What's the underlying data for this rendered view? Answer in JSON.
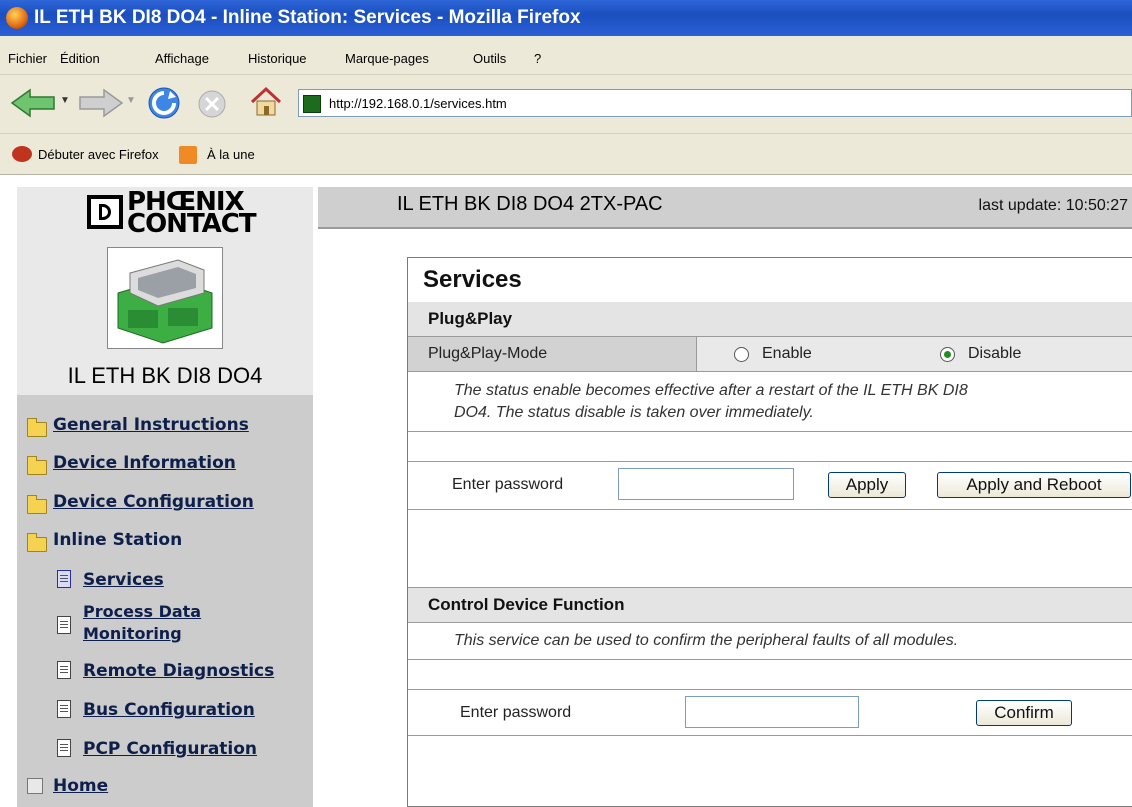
{
  "window": {
    "title": "IL ETH BK DI8 DO4 - Inline Station: Services - Mozilla Firefox"
  },
  "menu": {
    "items": [
      {
        "label": "Fichier"
      },
      {
        "label": "Édition"
      },
      {
        "label": "Affichage"
      },
      {
        "label": "Historique"
      },
      {
        "label": "Marque-pages"
      },
      {
        "label": "Outils"
      },
      {
        "label": "?"
      }
    ]
  },
  "toolbar": {
    "url": "http://192.168.0.1/services.htm"
  },
  "bookmarks": {
    "items": [
      {
        "label": "Débuter avec Firefox"
      },
      {
        "label": "À la une"
      }
    ]
  },
  "brand": {
    "logo_line1": "PHŒNIX",
    "logo_line2": "CONTACT",
    "device_label": "IL ETH BK DI8 DO4"
  },
  "header": {
    "device_title": "IL ETH BK DI8 DO4 2TX-PAC",
    "last_update": "last update: 10:50:27"
  },
  "sidebar": {
    "items": [
      {
        "label": "General Instructions",
        "icon": "folder-icon"
      },
      {
        "label": "Device Information",
        "icon": "folder-icon"
      },
      {
        "label": "Device Configuration",
        "icon": "folder-icon"
      },
      {
        "label": "Inline Station",
        "icon": "open-folder-icon"
      },
      {
        "label": "Services",
        "icon": "document-icon",
        "active": true
      },
      {
        "label_line1": "Process Data",
        "label_line2": "Monitoring",
        "icon": "document-icon"
      },
      {
        "label": "Remote Diagnostics",
        "icon": "document-icon"
      },
      {
        "label": "Bus Configuration",
        "icon": "document-icon"
      },
      {
        "label": "PCP Configuration",
        "icon": "document-icon"
      },
      {
        "label": "Home",
        "icon": "home-icon"
      }
    ]
  },
  "content": {
    "title": "Services",
    "plugplay": {
      "section": "Plug&Play",
      "mode_label": "Plug&Play-Mode",
      "enable_label": "Enable",
      "disable_label": "Disable",
      "selected": "Disable",
      "note_line1": "The status enable becomes effective after a restart of the IL ETH BK DI8",
      "note_line2": "DO4. The status disable is taken over immediately.",
      "password_label": "Enter password",
      "password_value": "",
      "apply_label": "Apply",
      "apply_reboot_label": "Apply and Reboot"
    },
    "control": {
      "section": "Control Device Function",
      "note": "This service can be used to confirm the peripheral faults of all modules.",
      "password_label": "Enter password",
      "password_value": "",
      "confirm_label": "Confirm"
    }
  }
}
